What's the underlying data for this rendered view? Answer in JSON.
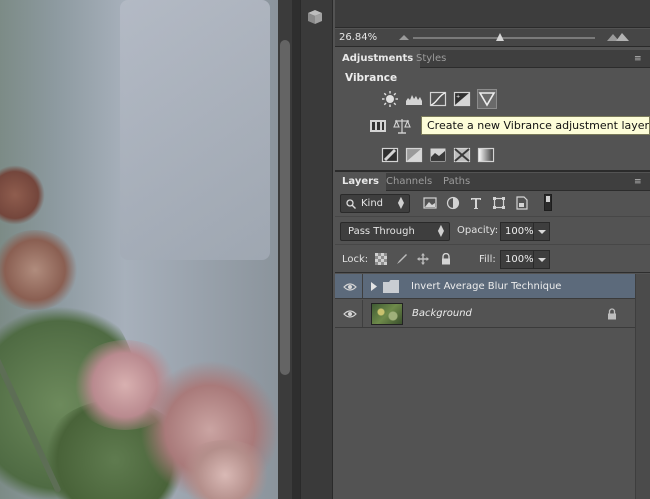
{
  "navigator": {
    "zoom": "26.84%",
    "zoom_slider_level": 0.48
  },
  "adjustments_panel": {
    "tabs": [
      {
        "label": "Adjustments",
        "active": true
      },
      {
        "label": "Styles",
        "active": false
      }
    ],
    "section_title": "Vibrance",
    "row1_icons": [
      "brightness-contrast-icon",
      "levels-icon",
      "curves-icon",
      "exposure-icon",
      "vibrance-icon"
    ],
    "row2_icons": [
      "hue-saturation-icon",
      "color-balance-icon"
    ],
    "row3_icons": [
      "invert-icon",
      "posterize-icon",
      "threshold-icon",
      "selective-color-icon",
      "gradient-map-icon"
    ],
    "tooltip": "Create a new Vibrance adjustment layer"
  },
  "layers_panel": {
    "tabs": [
      {
        "label": "Layers",
        "active": true
      },
      {
        "label": "Channels",
        "active": false
      },
      {
        "label": "Paths",
        "active": false
      }
    ],
    "filter_kind": "Kind",
    "filter_icons": [
      "pixel-filter-icon",
      "adjustment-filter-icon",
      "type-filter-icon",
      "shape-filter-icon",
      "smart-object-filter-icon"
    ],
    "blend_mode": "Pass Through",
    "opacity_label": "Opacity:",
    "opacity_value": "100%",
    "lock_label": "Lock:",
    "fill_label": "Fill:",
    "fill_value": "100%",
    "layers": [
      {
        "name": "Invert Average Blur Technique",
        "type": "group",
        "visible": true,
        "selected": true
      },
      {
        "name": "Background",
        "type": "image",
        "visible": true,
        "locked": true,
        "selected": false
      }
    ]
  },
  "colors": {
    "panel_bg": "#535353",
    "selected_layer": "#5c6a7b",
    "tooltip_bg": "#fdfdd8"
  }
}
